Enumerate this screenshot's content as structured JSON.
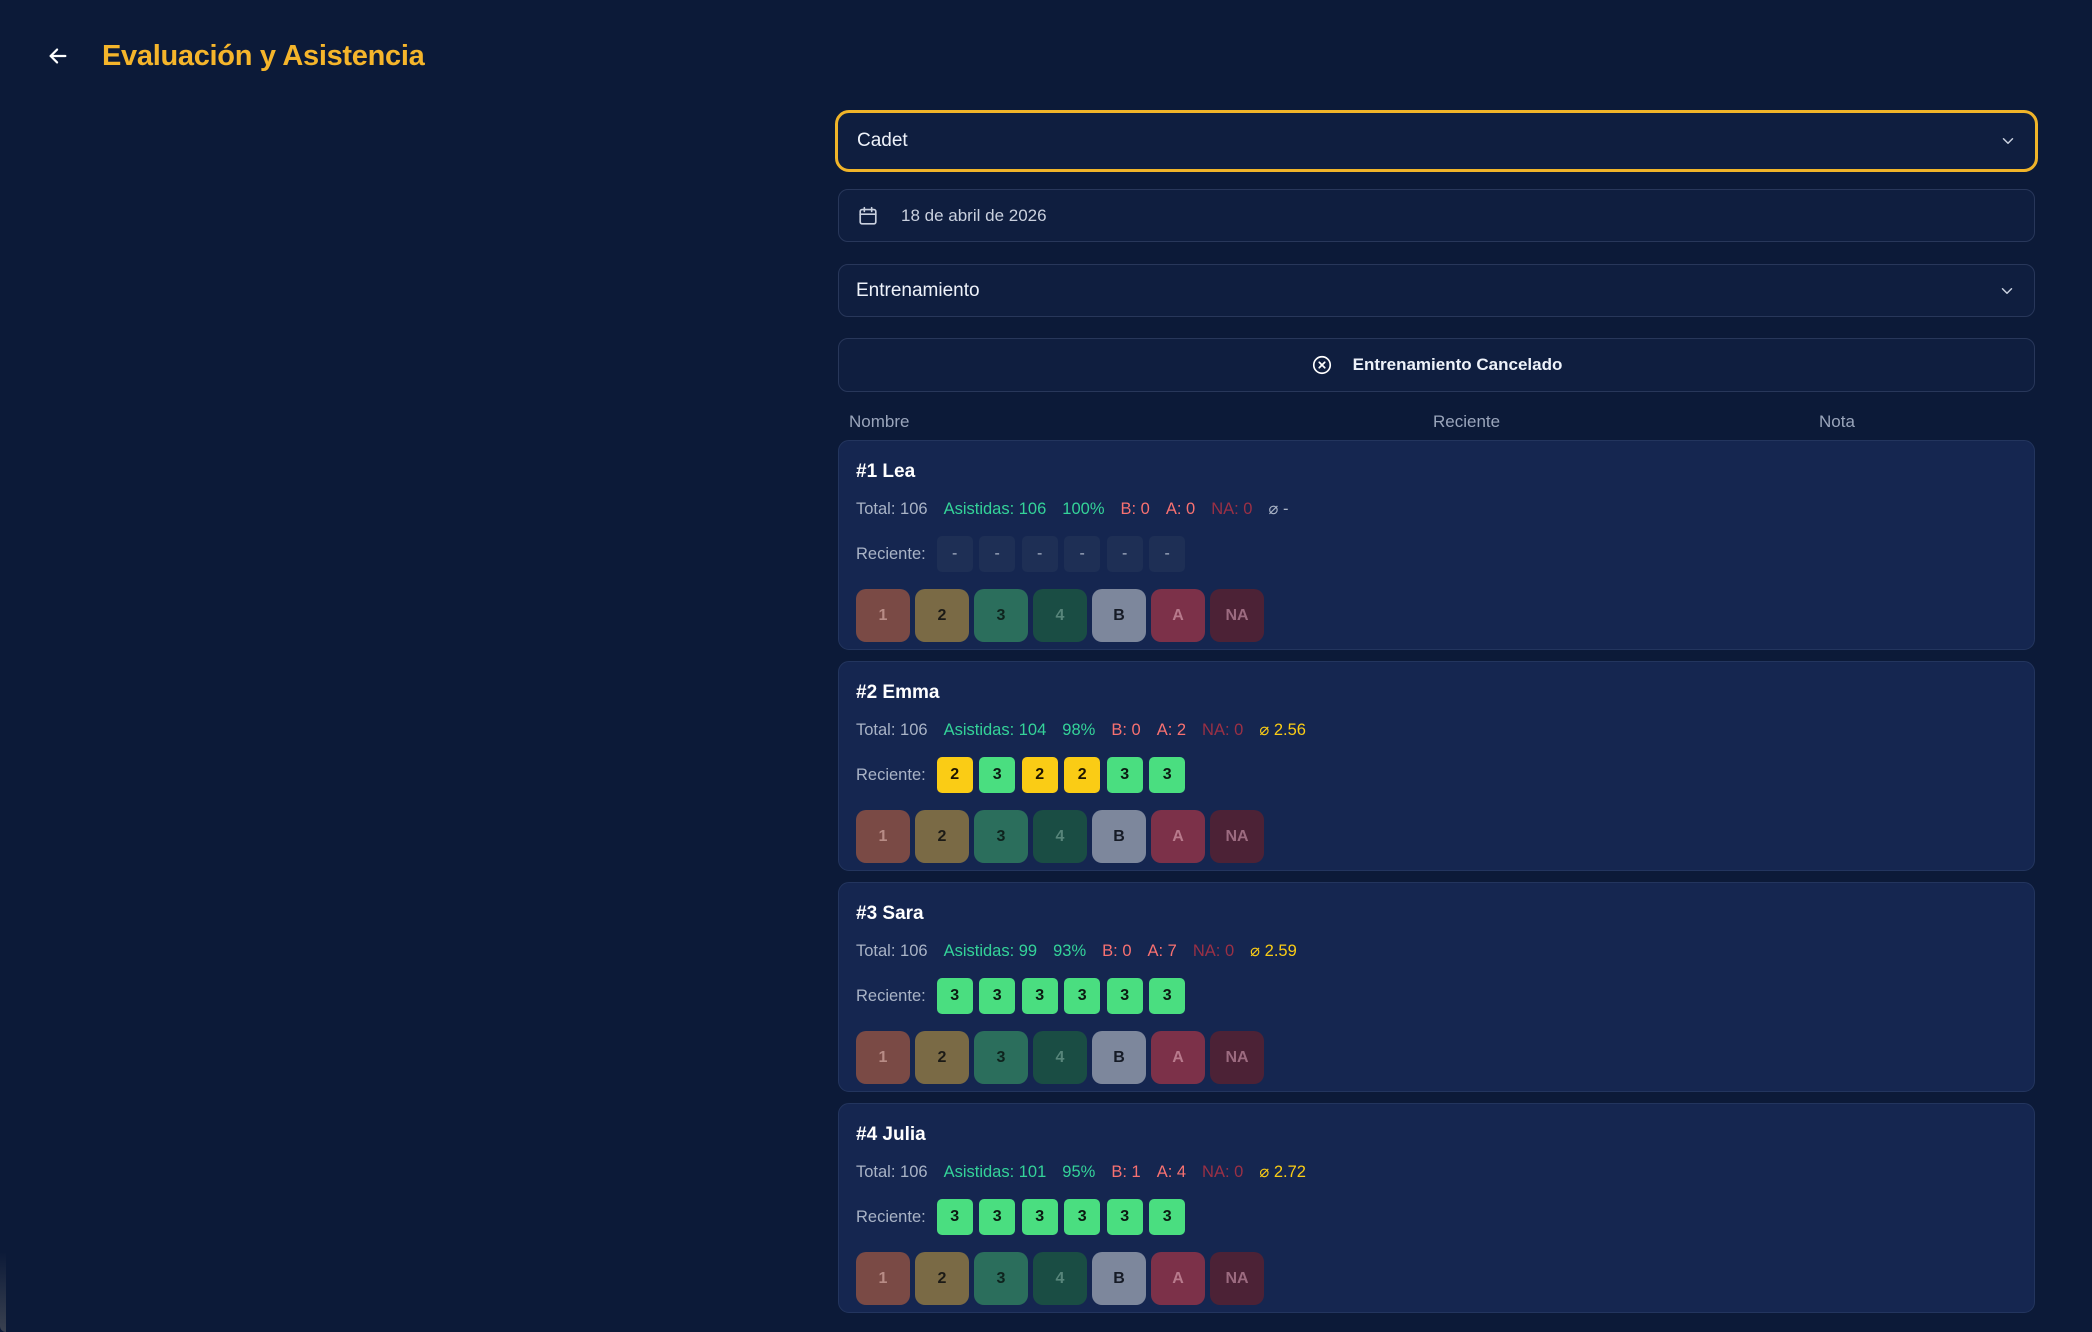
{
  "header": {
    "title": "Evaluación y Asistencia"
  },
  "filters": {
    "group": "Cadet",
    "date": "18 de abril de 2026",
    "session_type": "Entrenamiento",
    "cancel_label": "Entrenamiento Cancelado"
  },
  "columns": {
    "name": "Nombre",
    "recent": "Reciente",
    "grade": "Nota"
  },
  "recent_label": "Reciente:",
  "grade_buttons": [
    "1",
    "2",
    "3",
    "4",
    "B",
    "A",
    "NA"
  ],
  "players": [
    {
      "title": "#1 Lea",
      "total": "Total: 106",
      "attended": "Asistidas: 106",
      "percent": "100%",
      "b": "B: 0",
      "a": "A: 0",
      "na": "NA: 0",
      "avg": "⌀ -",
      "recent": [
        "-",
        "-",
        "-",
        "-",
        "-",
        "-"
      ]
    },
    {
      "title": "#2 Emma",
      "total": "Total: 106",
      "attended": "Asistidas: 104",
      "percent": "98%",
      "b": "B: 0",
      "a": "A: 2",
      "na": "NA: 0",
      "avg": "⌀ 2.56",
      "recent": [
        "2",
        "3",
        "2",
        "2",
        "3",
        "3"
      ]
    },
    {
      "title": "#3 Sara",
      "total": "Total: 106",
      "attended": "Asistidas: 99",
      "percent": "93%",
      "b": "B: 0",
      "a": "A: 7",
      "na": "NA: 0",
      "avg": "⌀ 2.59",
      "recent": [
        "3",
        "3",
        "3",
        "3",
        "3",
        "3"
      ]
    },
    {
      "title": "#4 Julia",
      "total": "Total: 106",
      "attended": "Asistidas: 101",
      "percent": "95%",
      "b": "B: 1",
      "a": "A: 4",
      "na": "NA: 0",
      "avg": "⌀ 2.72",
      "recent": [
        "3",
        "3",
        "3",
        "3",
        "3",
        "3"
      ]
    }
  ],
  "colors": {
    "background": "#0c1a38",
    "card": "#152650",
    "accent": "#f5b52b",
    "green": "#4ade80",
    "yellow": "#facc15",
    "red": "#f87171"
  },
  "icons": [
    "back-arrow-icon",
    "chevron-down-icon",
    "calendar-icon",
    "x-circle-icon"
  ]
}
